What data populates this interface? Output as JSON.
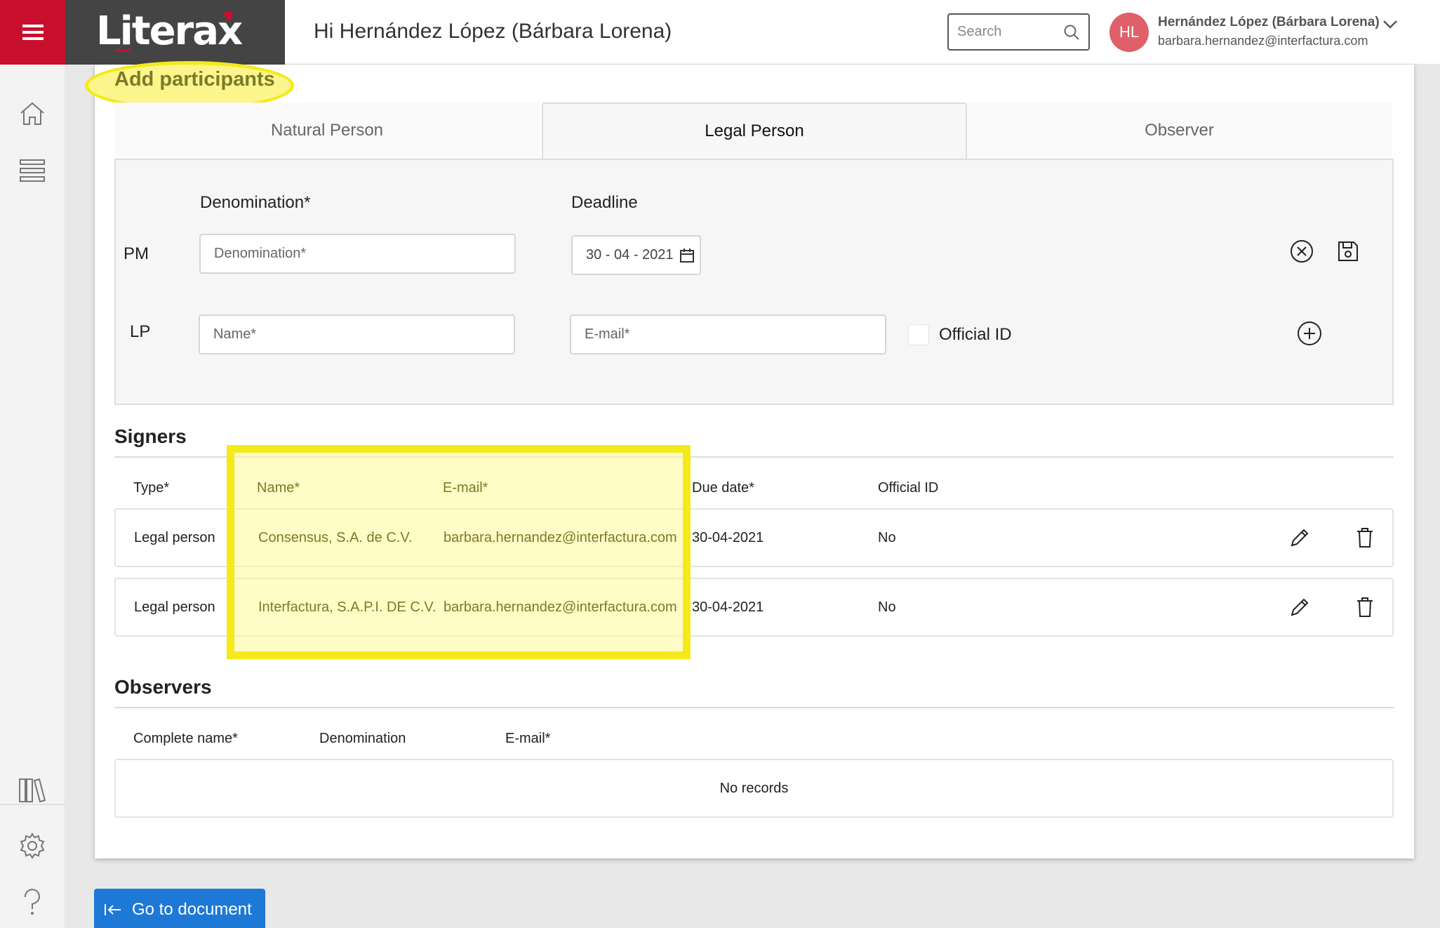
{
  "app": {
    "logo_text": "Literax",
    "brand_color": "#c8102e"
  },
  "header": {
    "greeting": "Hi Hernández López (Bárbara Lorena)",
    "search_placeholder": "Search",
    "avatar_initials": "HL",
    "user_name": "Hernández López (Bárbara Lorena)",
    "user_email": "barbara.hernandez@interfactura.com"
  },
  "sidebar": {
    "icons": [
      "home-icon",
      "list-icon",
      "library-icon",
      "settings-icon",
      "help-icon"
    ]
  },
  "page": {
    "title": "Add participants"
  },
  "tabs": [
    {
      "label": "Natural Person",
      "active": false
    },
    {
      "label": "Legal Person",
      "active": true
    },
    {
      "label": "Observer",
      "active": false
    }
  ],
  "form": {
    "pm_label": "PM",
    "lp_label": "LP",
    "denomination_label": "Denomination*",
    "denomination_placeholder": "Denomination*",
    "deadline_label": "Deadline",
    "deadline_value": "30 - 04 - 2021",
    "name_placeholder": "Name*",
    "email_placeholder": "E-mail*",
    "official_id_label": "Official ID",
    "official_id_checked": false
  },
  "signers": {
    "title": "Signers",
    "columns": [
      "Type*",
      "Name*",
      "E-mail*",
      "Due date*",
      "Official ID"
    ],
    "rows": [
      {
        "type": "Legal person",
        "name": "Consensus, S.A. de C.V.",
        "email": "barbara.hernandez@interfactura.com",
        "due": "30-04-2021",
        "official_id": "No"
      },
      {
        "type": "Legal person",
        "name": "Interfactura, S.A.P.I. DE C.V.",
        "email": "barbara.hernandez@interfactura.com",
        "due": "30-04-2021",
        "official_id": "No"
      }
    ]
  },
  "observers": {
    "title": "Observers",
    "columns": [
      "Complete name*",
      "Denomination",
      "E-mail*"
    ],
    "empty_text": "No records"
  },
  "footer": {
    "go_to_document": "Go to document"
  },
  "highlight_color": "#f4ea1a"
}
